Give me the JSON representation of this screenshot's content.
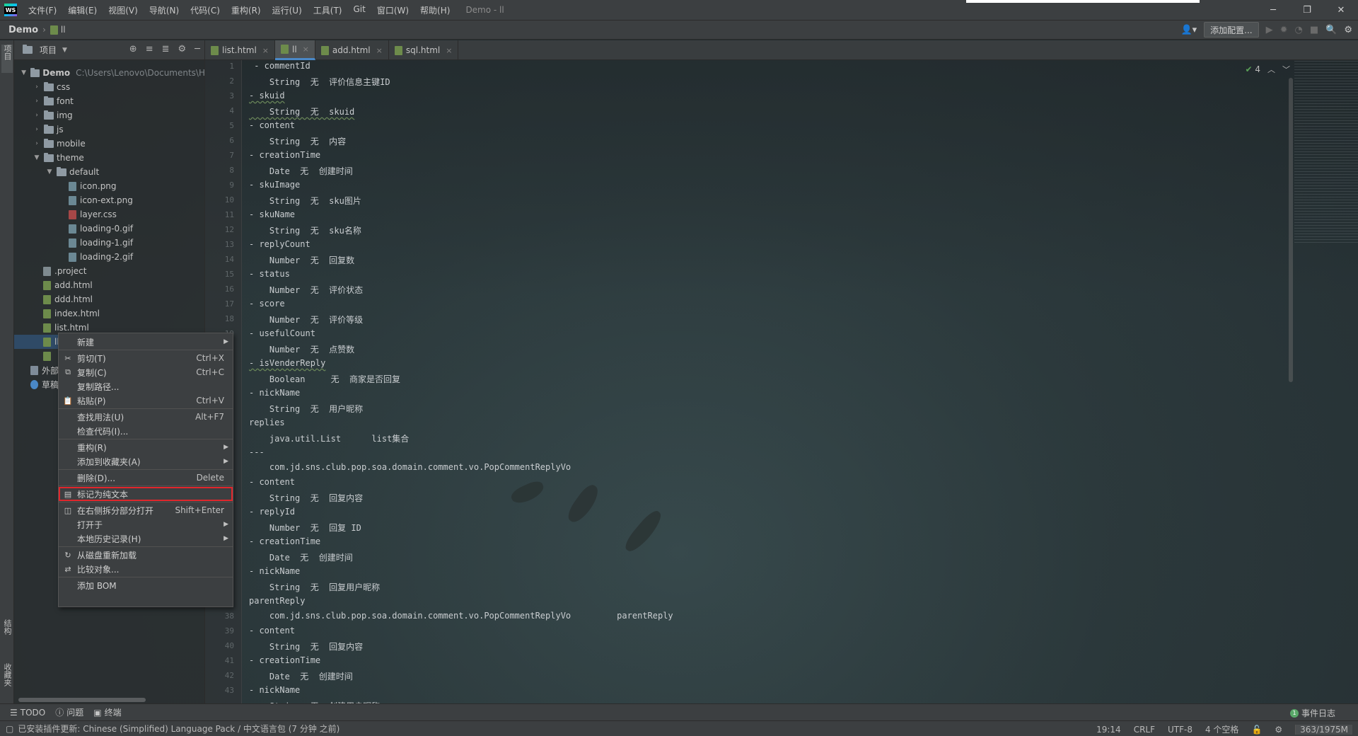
{
  "app": {
    "logo_text": "WS",
    "window_title": "Demo - ll",
    "menu": [
      "文件(F)",
      "编辑(E)",
      "视图(V)",
      "导航(N)",
      "代码(C)",
      "重构(R)",
      "运行(U)",
      "工具(T)",
      "Git",
      "窗口(W)",
      "帮助(H)"
    ]
  },
  "navbar": {
    "project": "Demo",
    "file": "ll",
    "add_config": "添加配置..."
  },
  "left_strip": {
    "project_tab": "项目",
    "structure_tab": "结构",
    "favorites_tab": "收藏夹"
  },
  "project_panel": {
    "title": "项目",
    "tree": [
      {
        "label": "Demo",
        "path": "C:\\Users\\Lenovo\\Documents\\H",
        "type": "root"
      },
      {
        "label": "css",
        "type": "folder"
      },
      {
        "label": "font",
        "type": "folder"
      },
      {
        "label": "img",
        "type": "folder"
      },
      {
        "label": "js",
        "type": "folder"
      },
      {
        "label": "mobile",
        "type": "folder"
      },
      {
        "label": "theme",
        "type": "folder-open"
      },
      {
        "label": "default",
        "type": "folder-open"
      },
      {
        "label": "icon.png",
        "type": "img"
      },
      {
        "label": "icon-ext.png",
        "type": "img"
      },
      {
        "label": "layer.css",
        "type": "css"
      },
      {
        "label": "loading-0.gif",
        "type": "img"
      },
      {
        "label": "loading-1.gif",
        "type": "img"
      },
      {
        "label": "loading-2.gif",
        "type": "img"
      },
      {
        "label": ".project",
        "type": "file"
      },
      {
        "label": "add.html",
        "type": "html"
      },
      {
        "label": "ddd.html",
        "type": "html"
      },
      {
        "label": "index.html",
        "type": "html"
      },
      {
        "label": "list.html",
        "type": "html"
      },
      {
        "label": "ll",
        "type": "html-selected"
      },
      {
        "label": "",
        "type": "html"
      },
      {
        "label": "外部",
        "type": "ext"
      },
      {
        "label": "草稿",
        "type": "scratch"
      }
    ]
  },
  "tabs": [
    {
      "label": "list.html",
      "active": false
    },
    {
      "label": "ll",
      "active": true
    },
    {
      "label": "add.html",
      "active": false
    },
    {
      "label": "sql.html",
      "active": false
    }
  ],
  "editor": {
    "inspection_count": "4",
    "line_numbers": [
      "1",
      "2",
      "3",
      "4",
      "5",
      "6",
      "7",
      "8",
      "9",
      "10",
      "11",
      "12",
      "13",
      "14",
      "15",
      "16",
      "17",
      "18",
      "19",
      "",
      "",
      "",
      "",
      "",
      "",
      "",
      "",
      "",
      "",
      "",
      "",
      "",
      "",
      "",
      "",
      "",
      "",
      "38",
      "39",
      "40",
      "41",
      "42",
      "43"
    ],
    "lines": [
      " - commentId",
      "    String  无  评价信息主键ID",
      "- skuid",
      "    String  无  skuid",
      "- content",
      "    String  无  内容",
      "- creationTime",
      "    Date  无  创建时间",
      "- skuImage",
      "    String  无  sku图片",
      "- skuName",
      "    String  无  sku名称",
      "- replyCount",
      "    Number  无  回复数",
      "- status",
      "    Number  无  评价状态",
      "- score",
      "    Number  无  评价等级",
      "- usefulCount",
      "    Number  无  点赞数",
      "- isVenderReply",
      "    Boolean     无  商家是否回复",
      "- nickName",
      "    String  无  用户昵称",
      "replies",
      "    java.util.List      list集合",
      "---",
      "    com.jd.sns.club.pop.soa.domain.comment.vo.PopCommentReplyVo",
      "- content",
      "    String  无  回复内容",
      "- replyId",
      "    Number  无  回复 ID",
      "- creationTime",
      "    Date  无  创建时间",
      "- nickName",
      "    String  无  回复用户昵称",
      "parentReply",
      "    com.jd.sns.club.pop.soa.domain.comment.vo.PopCommentReplyVo         parentReply",
      "- content",
      "    String  无  回复内容",
      "- creationTime",
      "    Date  无  创建时间",
      "- nickName",
      "    String  无  创建用户昵称"
    ]
  },
  "context_menu": {
    "items": [
      {
        "label": "新建",
        "shortcut": "",
        "submenu": true,
        "icon": ""
      },
      {
        "label": "剪切(T)",
        "shortcut": "Ctrl+X",
        "submenu": false,
        "icon": "scissors-icon"
      },
      {
        "label": "复制(C)",
        "shortcut": "Ctrl+C",
        "submenu": false,
        "icon": "copy-icon"
      },
      {
        "label": "复制路径...",
        "shortcut": "",
        "submenu": false,
        "icon": ""
      },
      {
        "label": "粘贴(P)",
        "shortcut": "Ctrl+V",
        "submenu": false,
        "icon": "paste-icon"
      },
      {
        "label": "查找用法(U)",
        "shortcut": "Alt+F7",
        "submenu": false,
        "icon": ""
      },
      {
        "label": "检查代码(I)...",
        "shortcut": "",
        "submenu": false,
        "icon": ""
      },
      {
        "label": "重构(R)",
        "shortcut": "",
        "submenu": true,
        "icon": ""
      },
      {
        "label": "添加到收藏夹(A)",
        "shortcut": "",
        "submenu": true,
        "icon": ""
      },
      {
        "label": "删除(D)...",
        "shortcut": "Delete",
        "submenu": false,
        "icon": ""
      },
      {
        "label": "标记为纯文本",
        "shortcut": "",
        "submenu": false,
        "icon": "plain-text-icon"
      },
      {
        "label": "在右侧拆分部分打开",
        "shortcut": "Shift+Enter",
        "submenu": false,
        "icon": "split-icon"
      },
      {
        "label": "打开于",
        "shortcut": "",
        "submenu": true,
        "icon": ""
      },
      {
        "label": "本地历史记录(H)",
        "shortcut": "",
        "submenu": true,
        "icon": ""
      },
      {
        "label": "从磁盘重新加载",
        "shortcut": "",
        "submenu": false,
        "icon": "reload-icon"
      },
      {
        "label": "比较对象...",
        "shortcut": "",
        "submenu": false,
        "icon": "compare-icon"
      },
      {
        "label": "添加 BOM",
        "shortcut": "",
        "submenu": false,
        "icon": ""
      }
    ]
  },
  "bottom_tools": {
    "todo": "TODO",
    "problems": "问题",
    "terminal": "终端",
    "event_log": "事件日志"
  },
  "status": {
    "message": "已安装插件更新: Chinese (Simplified) Language Pack / 中文语言包 (7 分钟 之前)",
    "position": "19:14",
    "line_sep": "CRLF",
    "encoding": "UTF-8",
    "indent": "4 个空格",
    "memory": "363/1975M"
  },
  "colors": {
    "selection": "#2f4a66",
    "highlight_border": "#e0262c",
    "accent_tab": "#4a88c7"
  }
}
